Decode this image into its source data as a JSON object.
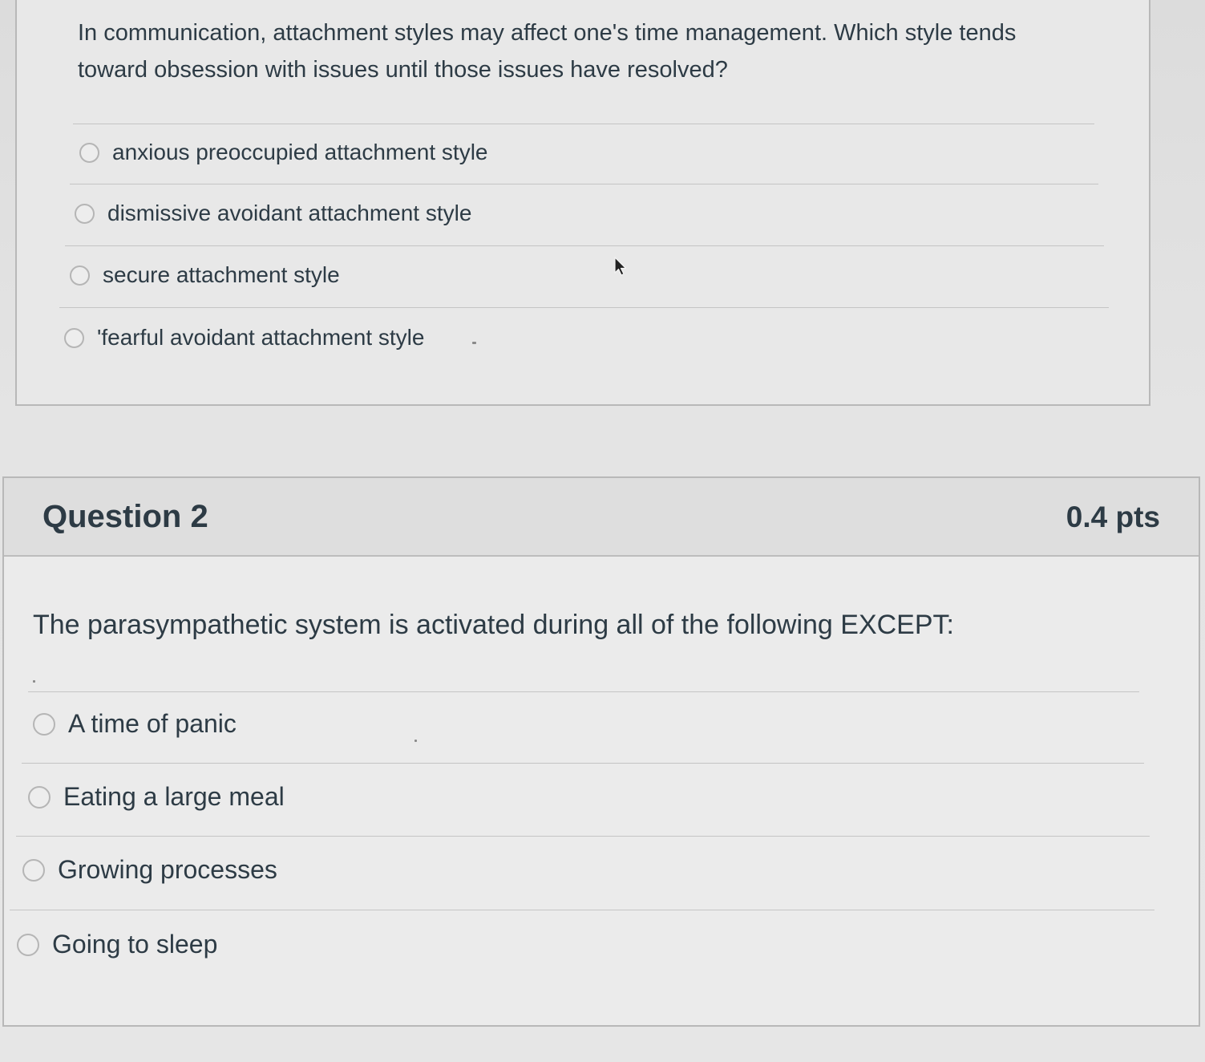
{
  "question1": {
    "text": "In communication, attachment styles may affect one's time management. Which style tends toward obsession with issues until those issues have resolved?",
    "answers": [
      "anxious preoccupied attachment style",
      "dismissive avoidant attachment style",
      "secure attachment style",
      "'fearful avoidant attachment style"
    ]
  },
  "question2": {
    "title": "Question 2",
    "points": "0.4 pts",
    "text": "The parasympathetic system is activated during all of the following EXCEPT:",
    "answers": [
      "A time of panic",
      "Eating a large meal",
      "Growing processes",
      "Going to sleep"
    ]
  },
  "icons": {
    "radio": "radio-button-empty-icon",
    "cursor": "mouse-pointer-icon"
  },
  "colors": {
    "text": "#2d3b45",
    "card_border": "#b8b8b8",
    "header_bg": "#dedede",
    "divider": "#c4c4c4"
  }
}
